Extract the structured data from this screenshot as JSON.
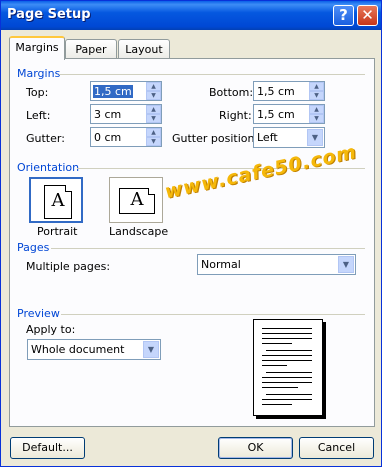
{
  "window": {
    "title": "Page Setup",
    "help": "?",
    "close": "✕"
  },
  "tabs": [
    {
      "label": "Margins"
    },
    {
      "label": "Paper"
    },
    {
      "label": "Layout"
    }
  ],
  "margins": {
    "section": "Margins",
    "top": {
      "label": "Top:",
      "value": "1,5 cm"
    },
    "bottom": {
      "label": "Bottom:",
      "value": "1,5 cm"
    },
    "left": {
      "label": "Left:",
      "value": "3 cm"
    },
    "right": {
      "label": "Right:",
      "value": "1,5 cm"
    },
    "gutter": {
      "label": "Gutter:",
      "value": "0 cm"
    },
    "gutter_position": {
      "label": "Gutter position:",
      "value": "Left"
    }
  },
  "orientation": {
    "section": "Orientation",
    "portrait": "Portrait",
    "landscape": "Landscape",
    "glyph": "A"
  },
  "pages": {
    "section": "Pages",
    "multiple_label": "Multiple pages:",
    "multiple_value": "Normal"
  },
  "preview": {
    "section": "Preview",
    "apply_label": "Apply to:",
    "apply_value": "Whole document"
  },
  "watermark": "www.cafe50.com",
  "buttons": {
    "default": "Default...",
    "ok": "OK",
    "cancel": "Cancel"
  },
  "icons": {
    "spin_up": "spin-up-arrow-icon",
    "spin_down": "spin-down-arrow-icon",
    "dropdown": "dropdown-arrow-icon"
  }
}
